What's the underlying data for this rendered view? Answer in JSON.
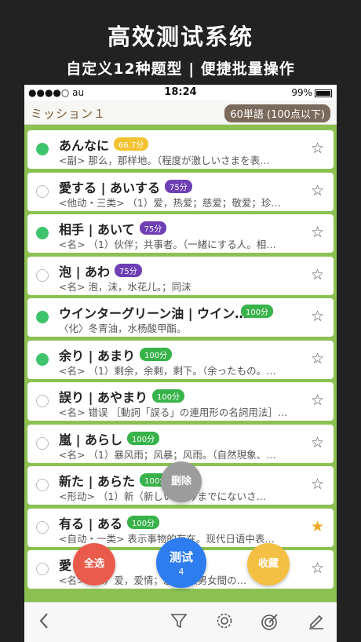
{
  "promo": {
    "title": "高效测试系统",
    "subtitle": "自定义12种题型 | 便捷批量操作"
  },
  "status_bar": {
    "signal": "●●●●○ au",
    "time": "18:24",
    "battery_text": "99%"
  },
  "nav": {
    "title": "ミッション１",
    "badge": "60単語 (100点以下)"
  },
  "items": [
    {
      "word": "あんなに",
      "score": "66.7分",
      "score_color": "gold",
      "def": "<副> 那么，那样地。（程度が激しいさまを表…",
      "done": true,
      "starred": false
    },
    {
      "word": "愛する | あいする",
      "score": "75分",
      "score_color": "purple",
      "def": "<他动・三类> （1）爱，热爱；慈爱；敬爱；珍…",
      "done": false,
      "starred": false
    },
    {
      "word": "相手 | あいて",
      "score": "75分",
      "score_color": "purple",
      "def": "<名> （1）伙伴；共事者。（一緒にする人。相…",
      "done": true,
      "starred": false
    },
    {
      "word": "泡 | あわ",
      "score": "75分",
      "score_color": "purple",
      "def": "<名> 泡，沫，水花儿。；同沫",
      "done": false,
      "starred": false
    },
    {
      "word": "ウインターグリーン油 | ウイン…",
      "score": "100分",
      "score_color": "green",
      "def": "〈化〉冬青油，水杨酸甲酯。",
      "done": true,
      "starred": false
    },
    {
      "word": "余り | あまり",
      "score": "100分",
      "score_color": "green",
      "def": "<名> （1）剩余，余剩，剩下。（余ったもの。…",
      "done": true,
      "starred": false
    },
    {
      "word": "誤り | あやまり",
      "score": "100分",
      "score_color": "green",
      "def": "<名> 错误 ［動詞「誤る」の連用形の名詞用法］…",
      "done": false,
      "starred": false
    },
    {
      "word": "嵐 | あらし",
      "score": "100分",
      "score_color": "green",
      "def": "<名> （1）暴风雨；风暴；风雨。（自然現象、…",
      "done": false,
      "starred": false
    },
    {
      "word": "新た | あらた",
      "score": "100分",
      "score_color": "green",
      "def": "<形动> （1）新（新しい）。今までにないさ…",
      "done": false,
      "starred": false
    },
    {
      "word": "有る | ある",
      "score": "100分",
      "score_color": "green",
      "def": "<自动・一类> 表示事物的存在。现代日语中表…",
      "done": false,
      "starred": true
    },
    {
      "word": "愛",
      "score": "",
      "score_color": "green",
      "def": "<名> （1）爱，爱情；恩爱。（男女間の…",
      "done": false,
      "starred": false
    }
  ],
  "fabs": {
    "delete": "删除",
    "select_all": "全选",
    "test": "测试",
    "test_count": "4",
    "favorite": "收藏"
  },
  "toolbar": {
    "icons": [
      "back-icon",
      "filter-icon",
      "settings-icon",
      "target-icon",
      "edit-icon"
    ]
  },
  "colors": {
    "accent_green": "#8cc152",
    "done_green": "#3ec46d",
    "star_orange": "#f5a623",
    "test_blue": "#2d7cf0",
    "select_red": "#ea5a4b",
    "fav_yellow": "#f4c044",
    "delete_gray": "#9c9c9c"
  }
}
